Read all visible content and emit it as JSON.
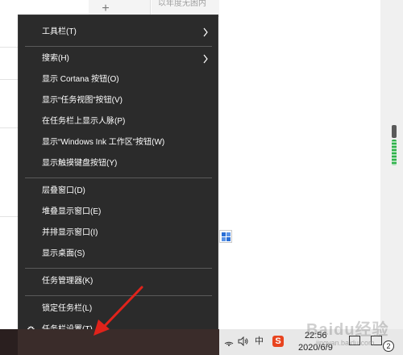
{
  "background": {
    "top_text": "以年度无困内",
    "plus": "+"
  },
  "menu": {
    "items": [
      {
        "label": "工具栏(T)",
        "submenu": true
      },
      {
        "label": "搜索(H)",
        "submenu": true
      },
      {
        "label": "显示 Cortana 按钮(O)",
        "submenu": false
      },
      {
        "label": "显示“任务视图”按钮(V)",
        "submenu": false
      },
      {
        "label": "在任务栏上显示人脉(P)",
        "submenu": false
      },
      {
        "label": "显示“Windows Ink 工作区”按钮(W)",
        "submenu": false
      },
      {
        "label": "显示触摸键盘按钮(Y)",
        "submenu": false
      },
      {
        "label": "层叠窗口(D)",
        "submenu": false
      },
      {
        "label": "堆叠显示窗口(E)",
        "submenu": false
      },
      {
        "label": "并排显示窗口(I)",
        "submenu": false
      },
      {
        "label": "显示桌面(S)",
        "submenu": false
      },
      {
        "label": "任务管理器(K)",
        "submenu": false
      },
      {
        "label": "锁定任务栏(L)",
        "submenu": false
      },
      {
        "label": "任务栏设置(T)",
        "submenu": false,
        "icon": "gear-icon"
      }
    ]
  },
  "taskbar": {
    "time": "22:56",
    "date": "2020/6/9",
    "ime_label": "中",
    "sogou_label": "S",
    "notification_count": "2"
  },
  "watermark": {
    "text": "Baidu经验",
    "sub": "jingyan.baidu.com"
  },
  "colors": {
    "menu_bg": "#2b2b2b",
    "menu_text": "#ffffff",
    "separator": "#5a5a5a",
    "arrow": "#e0231b",
    "scroll_green": "#2fb24a"
  }
}
